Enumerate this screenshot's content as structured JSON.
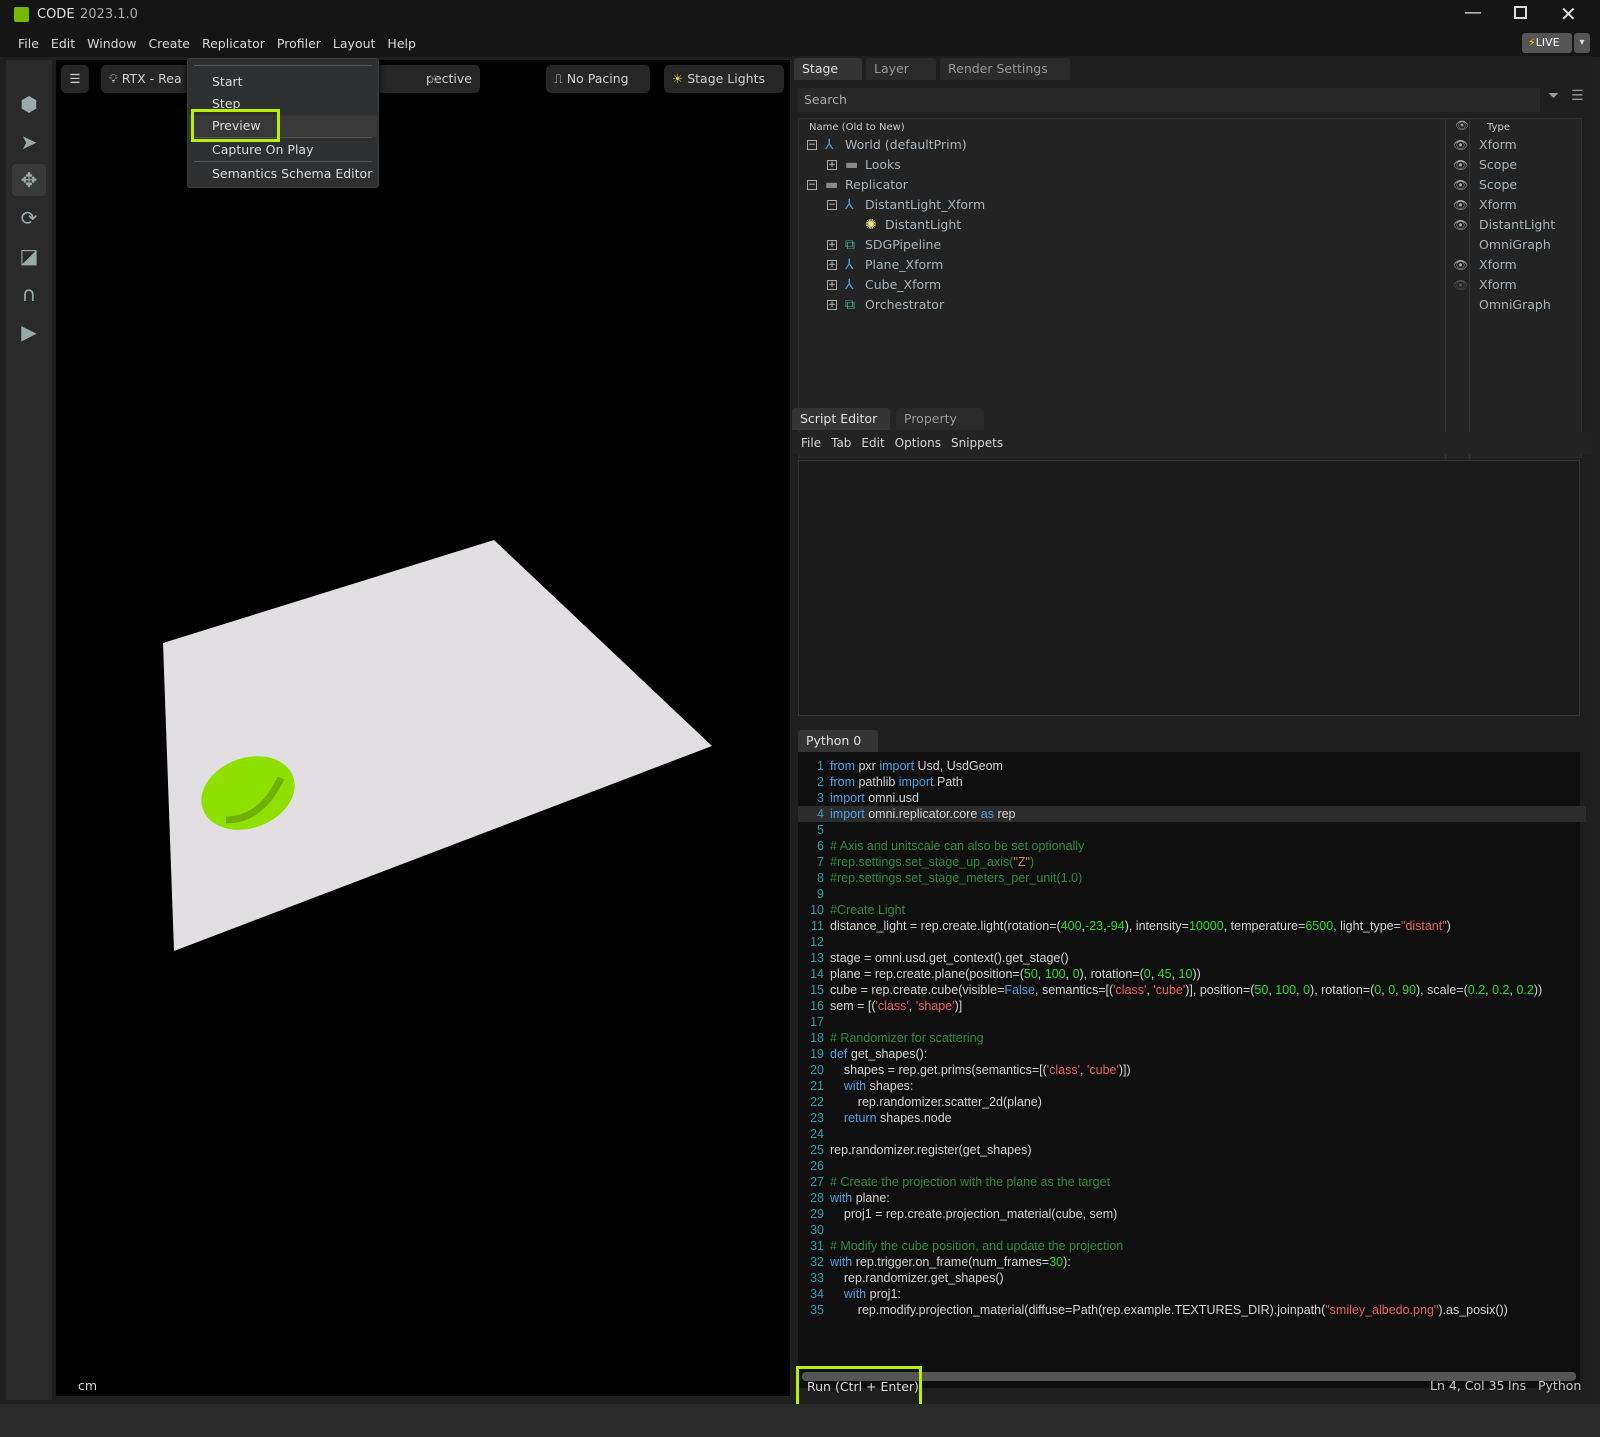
{
  "app": {
    "name": "CODE",
    "version": "2023.1.0",
    "live_label": "LIVE",
    "accent": "#76b900"
  },
  "menubar": [
    "File",
    "Edit",
    "Window",
    "Create",
    "Replicator",
    "Profiler",
    "Layout",
    "Help"
  ],
  "viewport": {
    "renderer": "RTX - Rea",
    "camera": "pective",
    "pacing": "No Pacing",
    "lights": "Stage Lights",
    "units": "cm"
  },
  "replicator_menu": {
    "items": [
      "Start",
      "Step",
      "Preview",
      "Capture On Play",
      "Semantics Schema Editor"
    ],
    "highlighted": "Preview"
  },
  "stage": {
    "tabs": [
      "Stage",
      "Layer",
      "Render Settings"
    ],
    "search_placeholder": "Search",
    "col_name": "Name (Old to New)",
    "col_type": "Type",
    "rows": [
      {
        "name": "World (defaultPrim)",
        "level": 0,
        "exp": "minus",
        "icon": "xform",
        "eye": "on",
        "type": "Xform"
      },
      {
        "name": "Looks",
        "level": 1,
        "exp": "plus",
        "icon": "folder",
        "eye": "on",
        "type": "Scope"
      },
      {
        "name": "Replicator",
        "level": 0,
        "exp": "minus",
        "icon": "folder",
        "eye": "on",
        "type": "Scope"
      },
      {
        "name": "DistantLight_Xform",
        "level": 1,
        "exp": "minus",
        "icon": "xform",
        "eye": "on",
        "type": "Xform"
      },
      {
        "name": "DistantLight",
        "level": 2,
        "exp": "none",
        "icon": "light",
        "eye": "on",
        "type": "DistantLight"
      },
      {
        "name": "SDGPipeline",
        "level": 1,
        "exp": "plus",
        "icon": "graph",
        "eye": "none",
        "type": "OmniGraph"
      },
      {
        "name": "Plane_Xform",
        "level": 1,
        "exp": "plus",
        "icon": "xform",
        "eye": "on",
        "type": "Xform"
      },
      {
        "name": "Cube_Xform",
        "level": 1,
        "exp": "plus",
        "icon": "xform",
        "eye": "off",
        "type": "Xform"
      },
      {
        "name": "Orchestrator",
        "level": 1,
        "exp": "plus",
        "icon": "graph",
        "eye": "none",
        "type": "OmniGraph"
      }
    ]
  },
  "script_editor": {
    "tabs": [
      "Script Editor",
      "Property"
    ],
    "menu": [
      "File",
      "Tab",
      "Edit",
      "Options",
      "Snippets"
    ],
    "file_tab": "Python 0",
    "current_line": 4,
    "run_label": "Run (Ctrl + Enter)",
    "status": {
      "position": "Ln 4, Col 35",
      "mode": "Ins",
      "language": "Python"
    },
    "code": [
      [
        [
          "k",
          "from"
        ],
        [
          "t",
          " pxr "
        ],
        [
          "k",
          "import"
        ],
        [
          "t",
          " Usd, UsdGeom"
        ]
      ],
      [
        [
          "k",
          "from"
        ],
        [
          "t",
          " pathlib "
        ],
        [
          "k",
          "import"
        ],
        [
          "t",
          " Path"
        ]
      ],
      [
        [
          "k",
          "import"
        ],
        [
          "t",
          " omni.usd"
        ]
      ],
      [
        [
          "k",
          "import"
        ],
        [
          "t",
          " omni.replicator.core "
        ],
        [
          "k",
          "as"
        ],
        [
          "t",
          " rep"
        ]
      ],
      [],
      [
        [
          "c",
          "# Axis and unitscale can also be set optionally"
        ]
      ],
      [
        [
          "c",
          "#rep.settings.set_stage_up_axis("
        ],
        [
          "o",
          "\"Z\""
        ],
        [
          "c",
          ")"
        ]
      ],
      [
        [
          "c",
          "#rep.settings.set_stage_meters_per_unit(1.0)"
        ]
      ],
      [],
      [
        [
          "c",
          "#Create Light"
        ]
      ],
      [
        [
          "t",
          "distance_light = rep.create.light(rotation=("
        ],
        [
          "n",
          "400"
        ],
        [
          "t",
          ","
        ],
        [
          "n",
          "-23"
        ],
        [
          "t",
          ","
        ],
        [
          "n",
          "-94"
        ],
        [
          "t",
          "), intensity="
        ],
        [
          "n",
          "10000"
        ],
        [
          "t",
          ", temperature="
        ],
        [
          "n",
          "6500"
        ],
        [
          "t",
          ", light_type="
        ],
        [
          "s",
          "\"distant\""
        ],
        [
          "t",
          ")"
        ]
      ],
      [],
      [
        [
          "t",
          "stage = omni.usd.get_context().get_stage()"
        ]
      ],
      [
        [
          "t",
          "plane = rep.create.plane(position=("
        ],
        [
          "n",
          "50"
        ],
        [
          "t",
          ", "
        ],
        [
          "n",
          "100"
        ],
        [
          "t",
          ", "
        ],
        [
          "n",
          "0"
        ],
        [
          "t",
          "), rotation=("
        ],
        [
          "n",
          "0"
        ],
        [
          "t",
          ", "
        ],
        [
          "n",
          "45"
        ],
        [
          "t",
          ", "
        ],
        [
          "n",
          "10"
        ],
        [
          "t",
          "))"
        ]
      ],
      [
        [
          "t",
          "cube = rep.create.cube(visible="
        ],
        [
          "k",
          "False"
        ],
        [
          "t",
          ", semantics=[("
        ],
        [
          "s",
          "'class'"
        ],
        [
          "t",
          ", "
        ],
        [
          "s",
          "'cube'"
        ],
        [
          "t",
          ")], position=("
        ],
        [
          "n",
          "50"
        ],
        [
          "t",
          ", "
        ],
        [
          "n",
          "100"
        ],
        [
          "t",
          ", "
        ],
        [
          "n",
          "0"
        ],
        [
          "t",
          "), rotation=("
        ],
        [
          "n",
          "0"
        ],
        [
          "t",
          ", "
        ],
        [
          "n",
          "0"
        ],
        [
          "t",
          ", "
        ],
        [
          "n",
          "90"
        ],
        [
          "t",
          "), scale=("
        ],
        [
          "n",
          "0.2"
        ],
        [
          "t",
          ", "
        ],
        [
          "n",
          "0.2"
        ],
        [
          "t",
          ", "
        ],
        [
          "n",
          "0.2"
        ],
        [
          "t",
          "))"
        ]
      ],
      [
        [
          "t",
          "sem = [("
        ],
        [
          "s",
          "'class'"
        ],
        [
          "t",
          ", "
        ],
        [
          "s",
          "'shape'"
        ],
        [
          "t",
          ")]"
        ]
      ],
      [],
      [
        [
          "c",
          "# Randomizer for scattering"
        ]
      ],
      [
        [
          "k",
          "def"
        ],
        [
          "t",
          " get_shapes():"
        ]
      ],
      [
        [
          "t",
          "    shapes = rep.get.prims(semantics=[("
        ],
        [
          "s",
          "'class'"
        ],
        [
          "t",
          ", "
        ],
        [
          "s",
          "'cube'"
        ],
        [
          "t",
          ")])"
        ]
      ],
      [
        [
          "t",
          "    "
        ],
        [
          "k",
          "with"
        ],
        [
          "t",
          " shapes:"
        ]
      ],
      [
        [
          "t",
          "        rep.randomizer.scatter_2d(plane)"
        ]
      ],
      [
        [
          "t",
          "    "
        ],
        [
          "k",
          "return"
        ],
        [
          "t",
          " shapes.node"
        ]
      ],
      [],
      [
        [
          "t",
          "rep.randomizer.register(get_shapes)"
        ]
      ],
      [],
      [
        [
          "c",
          "# Create the projection with the plane as the target"
        ]
      ],
      [
        [
          "k",
          "with"
        ],
        [
          "t",
          " plane:"
        ]
      ],
      [
        [
          "t",
          "    proj1 = rep.create.projection_material(cube, sem)"
        ]
      ],
      [],
      [
        [
          "c",
          "# Modify the cube position, and update the projection"
        ]
      ],
      [
        [
          "k",
          "with"
        ],
        [
          "t",
          " rep.trigger.on_frame(num_frames="
        ],
        [
          "n",
          "30"
        ],
        [
          "t",
          "):"
        ]
      ],
      [
        [
          "t",
          "    rep.randomizer.get_shapes()"
        ]
      ],
      [
        [
          "t",
          "    "
        ],
        [
          "k",
          "with"
        ],
        [
          "t",
          " proj1:"
        ]
      ],
      [
        [
          "t",
          "        rep.modify.projection_material(diffuse=Path(rep.example.TEXTURES_DIR).joinpath("
        ],
        [
          "s",
          "\"smiley_albedo.png\""
        ],
        [
          "t",
          ").as_posix())"
        ]
      ]
    ]
  }
}
